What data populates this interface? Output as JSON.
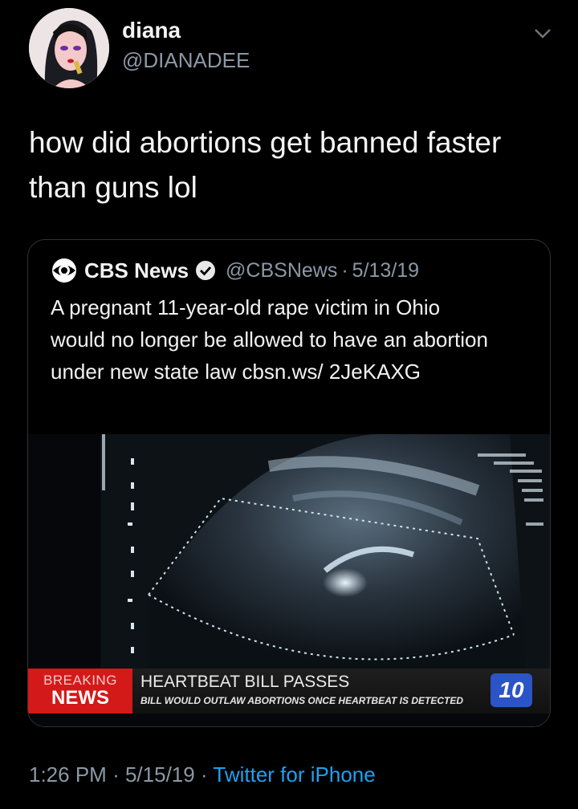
{
  "author": {
    "display_name": "diana",
    "handle": "@DIANADEE"
  },
  "tweet": {
    "text": "how did abortions get banned faster than guns lol",
    "time": "1:26 PM",
    "date": "5/15/19",
    "separator": "·",
    "source": "Twitter for iPhone"
  },
  "quoted": {
    "name": "CBS News",
    "handle": "@CBSNews",
    "separator": "·",
    "date": "5/13/19",
    "text": "A pregnant 11-year-old rape victim in Ohio would no longer be allowed to have an abortion under new state law cbsn.ws/ 2JeKAXG",
    "media": {
      "breaking_line1": "BREAKING",
      "breaking_line2": "NEWS",
      "headline": "HEARTBEAT BILL PASSES",
      "subheadline": "BILL WOULD OUTLAW ABORTIONS ONCE HEARTBEAT IS DETECTED",
      "channel": "10"
    }
  },
  "colors": {
    "background": "#000000",
    "secondary_text": "#8b98a5",
    "link": "#1da1f2",
    "breaking_red": "#d41919",
    "channel_blue": "#2b54c7"
  },
  "icons": {
    "verified": "verified-badge-icon",
    "caret": "chevron-down-icon",
    "cbs": "cbs-eye-logo"
  }
}
